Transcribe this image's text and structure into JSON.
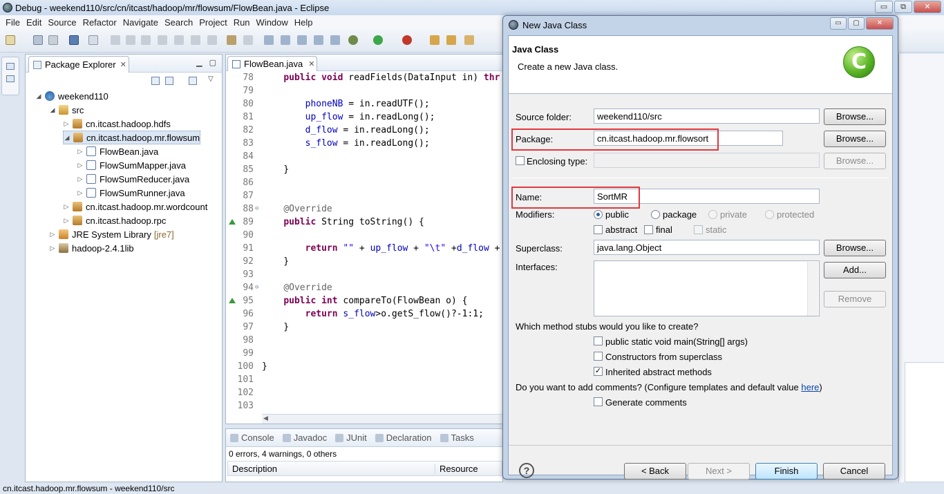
{
  "window": {
    "title": "Debug - weekend110/src/cn/itcast/hadoop/mr/flowsum/FlowBean.java - Eclipse",
    "controls": [
      "▭",
      "⧉",
      "✕"
    ]
  },
  "menu": [
    "File",
    "Edit",
    "Source",
    "Refactor",
    "Navigate",
    "Search",
    "Project",
    "Run",
    "Window",
    "Help"
  ],
  "package_explorer": {
    "tab": "Package Explorer",
    "tree": [
      {
        "label": "weekend110",
        "icon": "project-icon",
        "indent": 0,
        "expanded": true
      },
      {
        "label": "src",
        "icon": "source-folder-icon",
        "indent": 1,
        "expanded": true
      },
      {
        "label": "cn.itcast.hadoop.hdfs",
        "icon": "package-icon",
        "indent": 2,
        "expanded": false
      },
      {
        "label": "cn.itcast.hadoop.mr.flowsum",
        "icon": "package-icon",
        "indent": 2,
        "expanded": true,
        "selected": true
      },
      {
        "label": "FlowBean.java",
        "icon": "java-file-icon",
        "indent": 3,
        "expanded": false
      },
      {
        "label": "FlowSumMapper.java",
        "icon": "java-file-icon",
        "indent": 3,
        "expanded": false
      },
      {
        "label": "FlowSumReducer.java",
        "icon": "java-file-icon",
        "indent": 3,
        "expanded": false
      },
      {
        "label": "FlowSumRunner.java",
        "icon": "java-file-icon",
        "indent": 3,
        "expanded": false
      },
      {
        "label": "cn.itcast.hadoop.mr.wordcount",
        "icon": "package-icon",
        "indent": 2,
        "expanded": false
      },
      {
        "label": "cn.itcast.hadoop.rpc",
        "icon": "package-icon",
        "indent": 2,
        "expanded": false
      },
      {
        "label": "JRE System Library",
        "suffix": "[jre7]",
        "icon": "jre-library-icon",
        "indent": 1,
        "expanded": false
      },
      {
        "label": "hadoop-2.4.1lib",
        "icon": "library-icon",
        "indent": 1,
        "expanded": false
      }
    ]
  },
  "editor": {
    "tab": "FlowBean.java",
    "lines": [
      {
        "n": "78",
        "text": "    public void readFields(DataInput in) thr"
      },
      {
        "n": "79",
        "text": ""
      },
      {
        "n": "80",
        "text": "        phoneNB = in.readUTF();"
      },
      {
        "n": "81",
        "text": "        up_flow = in.readLong();"
      },
      {
        "n": "82",
        "text": "        d_flow = in.readLong();"
      },
      {
        "n": "83",
        "text": "        s_flow = in.readLong();"
      },
      {
        "n": "84",
        "text": ""
      },
      {
        "n": "85",
        "text": "    }"
      },
      {
        "n": "86",
        "text": ""
      },
      {
        "n": "87",
        "text": ""
      },
      {
        "n": "88",
        "text": "    @Override"
      },
      {
        "n": "89",
        "text": "    public String toString() {"
      },
      {
        "n": "90",
        "text": ""
      },
      {
        "n": "91",
        "text": "        return \"\" + up_flow + \"\\t\" +d_flow +"
      },
      {
        "n": "92",
        "text": "    }"
      },
      {
        "n": "93",
        "text": ""
      },
      {
        "n": "94",
        "text": "    @Override"
      },
      {
        "n": "95",
        "text": "    public int compareTo(FlowBean o) {"
      },
      {
        "n": "96",
        "text": "        return s_flow>o.getS_flow()?-1:1;"
      },
      {
        "n": "97",
        "text": "    }"
      },
      {
        "n": "98",
        "text": ""
      },
      {
        "n": "99",
        "text": ""
      },
      {
        "n": "100",
        "text": "}"
      },
      {
        "n": "101",
        "text": ""
      },
      {
        "n": "102",
        "text": ""
      },
      {
        "n": "103",
        "text": ""
      }
    ]
  },
  "bottom": {
    "tabs": [
      "Console",
      "Javadoc",
      "JUnit",
      "Declaration",
      "Tasks"
    ],
    "summary": "0 errors, 4 warnings, 0 others",
    "col_description": "Description",
    "col_resource": "Resource"
  },
  "status_bar": "cn.itcast.hadoop.mr.flowsum - weekend110/src",
  "dialog": {
    "title": "New Java Class",
    "controls": [
      "▭",
      "▢",
      "✕"
    ],
    "header_title": "Java Class",
    "header_subtitle": "Create a new Java class.",
    "logo_letter": "C",
    "source_folder_label": "Source folder:",
    "source_folder_value": "weekend110/src",
    "package_label": "Package:",
    "package_value": "cn.itcast.hadoop.mr.flowsort",
    "enclosing_label": "Enclosing type:",
    "name_label": "Name:",
    "name_value": "SortMR",
    "modifiers_label": "Modifiers:",
    "mod_public": "public",
    "mod_package": "package",
    "mod_private": "private",
    "mod_protected": "protected",
    "mod_abstract": "abstract",
    "mod_final": "final",
    "mod_static": "static",
    "superclass_label": "Superclass:",
    "superclass_value": "java.lang.Object",
    "interfaces_label": "Interfaces:",
    "stubs_question": "Which method stubs would you like to create?",
    "stub_main": "public static void main(String[] args)",
    "stub_constructors": "Constructors from superclass",
    "stub_inherited": "Inherited abstract methods",
    "comments_question": "Do you want to add comments? (Configure templates and default value ",
    "comments_link": "here",
    "comments_close": ")",
    "generate_comments": "Generate comments",
    "browse": "Browse...",
    "add": "Add...",
    "remove": "Remove",
    "back": "< Back",
    "next": "Next >",
    "finish": "Finish",
    "cancel": "Cancel",
    "check_mark": "✓",
    "help_glyph": "?"
  }
}
